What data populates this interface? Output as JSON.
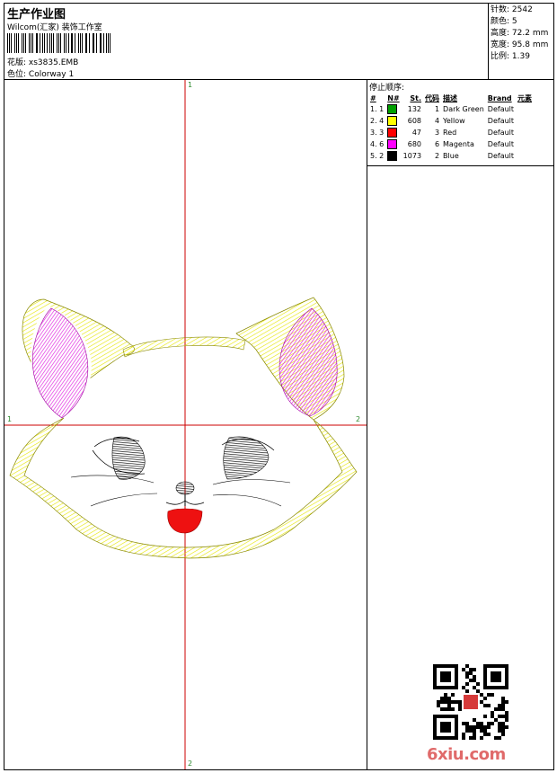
{
  "header": {
    "title": "生产作业图",
    "software": "Wilcom(汇家) 装饰工作室",
    "design_label": "花版:",
    "design_value": "xs3835.EMB",
    "colorway_label": "色位:",
    "colorway_value": "Colorway 1"
  },
  "specs": [
    {
      "label": "针数:",
      "value": "2542"
    },
    {
      "label": "颜色:",
      "value": "5"
    },
    {
      "label": "高度:",
      "value": "72.2 mm"
    },
    {
      "label": "宽度:",
      "value": "95.8 mm"
    },
    {
      "label": "比例:",
      "value": "1.39"
    }
  ],
  "stop_sequence": {
    "title": "停止顺序:",
    "columns": [
      "#",
      "N#",
      "St.",
      "代码",
      "描述",
      "Brand",
      "元素"
    ],
    "rows": [
      {
        "idx": "1. 1",
        "color": "#00a000",
        "stitches": "132",
        "code": "1",
        "desc": "Dark Green",
        "brand": "Default"
      },
      {
        "idx": "2. 4",
        "color": "#ffff00",
        "stitches": "608",
        "code": "4",
        "desc": "Yellow",
        "brand": "Default"
      },
      {
        "idx": "3. 3",
        "color": "#ff0000",
        "stitches": "47",
        "code": "3",
        "desc": "Red",
        "brand": "Default"
      },
      {
        "idx": "4. 6",
        "color": "#ff00ff",
        "stitches": "680",
        "code": "6",
        "desc": "Magenta",
        "brand": "Default"
      },
      {
        "idx": "5. 2",
        "color": "#000000",
        "stitches": "1073",
        "code": "2",
        "desc": "Blue",
        "brand": "Default"
      }
    ]
  },
  "axes": {
    "top": "1",
    "bottom": "2",
    "left": "1",
    "right": "2"
  },
  "watermark": {
    "site": "6xiu.com"
  },
  "colors": {
    "crosshair": "#cc0000",
    "outline_yellow": "#f5f57a",
    "ear_magenta": "#e040e0",
    "mouth_red": "#ee1111"
  }
}
